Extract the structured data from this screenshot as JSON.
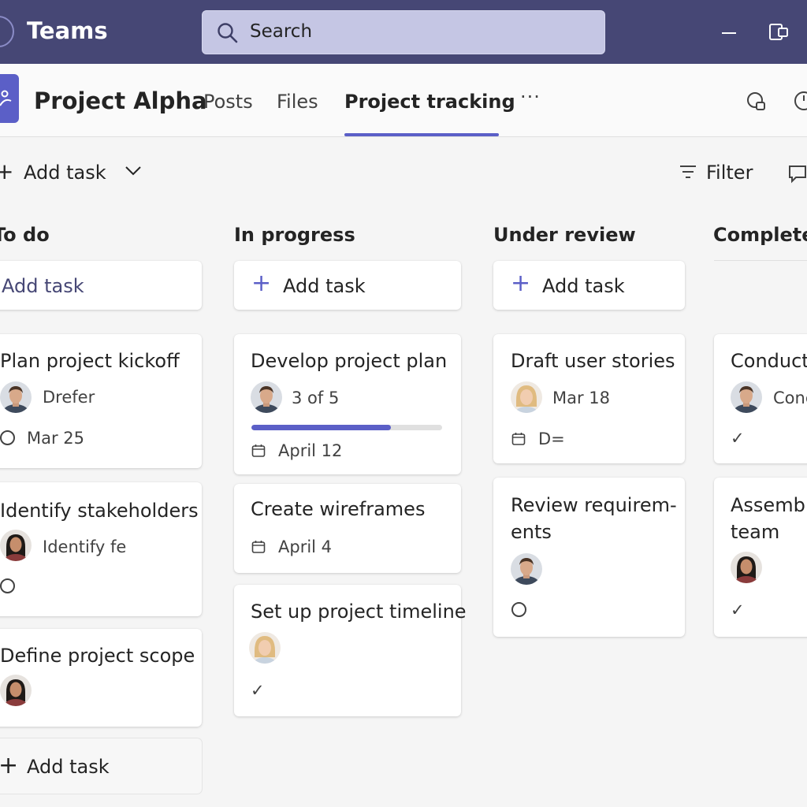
{
  "app": {
    "title": "Teams"
  },
  "search": {
    "label": "Search"
  },
  "channel": {
    "name": "Project Alpha",
    "tabs": [
      "Posts",
      "Files",
      "Project tracking"
    ],
    "active_tab": "Project tracking",
    "more": "···"
  },
  "toolbar": {
    "add_task": "Add task",
    "filter": "Filter"
  },
  "columns": [
    {
      "title": "To do",
      "add_task": "Add task",
      "tasks": [
        {
          "title": "Plan project kickoff",
          "assignee": "Drefer",
          "date": "Mar 25",
          "status": "not-started"
        },
        {
          "title": "Identify stakeholders",
          "assignee": "Identify fe",
          "status": "not-started"
        },
        {
          "title": "Define project scope"
        }
      ],
      "bottom_add": "Add task"
    },
    {
      "title": "In progress",
      "add_task": "Add task",
      "tasks": [
        {
          "title": "Develop project plan",
          "checklist": "3 of 5",
          "progress": 0.73,
          "date": "April 12"
        },
        {
          "title": "Create wireframes",
          "date": "April 4"
        },
        {
          "title": "Set up project timeline",
          "status": "completed"
        }
      ]
    },
    {
      "title": "Under review",
      "add_task": "Add task",
      "tasks": [
        {
          "title": "Draft user stories",
          "date": "Mar 18",
          "extra": "D="
        },
        {
          "title_lines": [
            "Review requirem-",
            "ents"
          ],
          "status": "not-started"
        }
      ]
    },
    {
      "title": "Completed",
      "tasks": [
        {
          "title": "Conduct",
          "assignee": "Conc",
          "status": "completed"
        },
        {
          "title_lines": [
            "Assemble",
            "team"
          ],
          "status": "completed"
        }
      ]
    }
  ],
  "colors": {
    "titlebar": "#464775",
    "accent": "#5b5fc7",
    "search": "#c5c6e4",
    "background": "#f5f5f5"
  }
}
